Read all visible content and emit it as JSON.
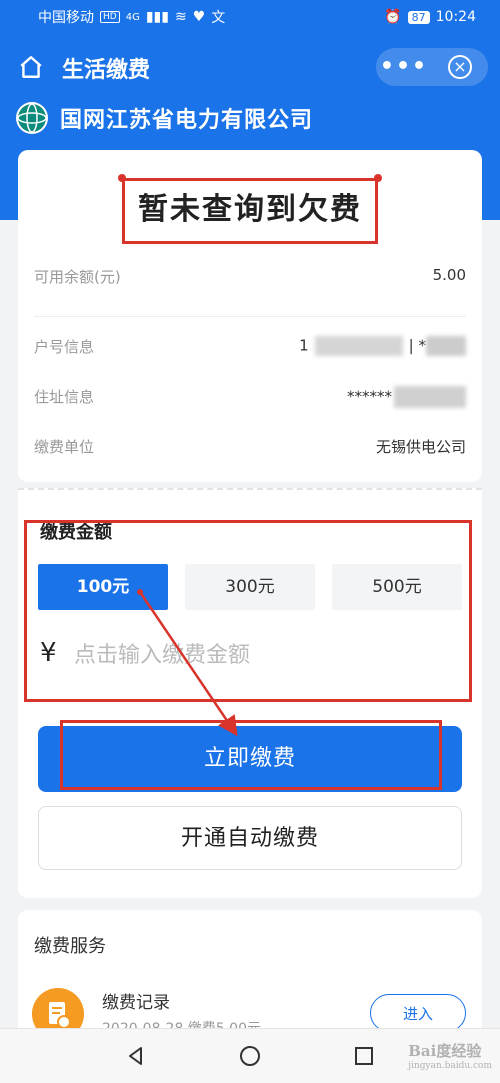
{
  "status_bar": {
    "carrier": "中国移动",
    "hd": "HD",
    "signal": "4G",
    "extra_icon": "文",
    "battery": "87",
    "time": "10:24"
  },
  "header": {
    "title": "生活缴费",
    "more": "•••",
    "close": "×",
    "company": "国网江苏省电力有限公司"
  },
  "account": {
    "no_arrears": "暂未查询到欠费",
    "balance_label": "可用余额(元)",
    "balance_value": "5.00",
    "account_label": "户号信息",
    "account_value_prefix": "1",
    "account_value_mid": "| *",
    "address_label": "住址信息",
    "address_value": "******",
    "unit_label": "缴费单位",
    "unit_value": "无锡供电公司"
  },
  "payment": {
    "title": "缴费金额",
    "options": [
      "100元",
      "300元",
      "500元"
    ],
    "selected_index": 0,
    "currency": "¥",
    "input_placeholder": "点击输入缴费金额",
    "pay_button": "立即缴费",
    "auto_button": "开通自动缴费"
  },
  "services": {
    "title": "缴费服务",
    "record_title": "缴费记录",
    "record_sub": "2020-08-28 缴费5.00元",
    "enter_button": "进入"
  },
  "watermark": {
    "brand": "Bai度经验",
    "url": "jingyan.baidu.com"
  },
  "colors": {
    "primary": "#1a73e8",
    "annotation": "#d9342b",
    "record_icon": "#f59a23"
  }
}
